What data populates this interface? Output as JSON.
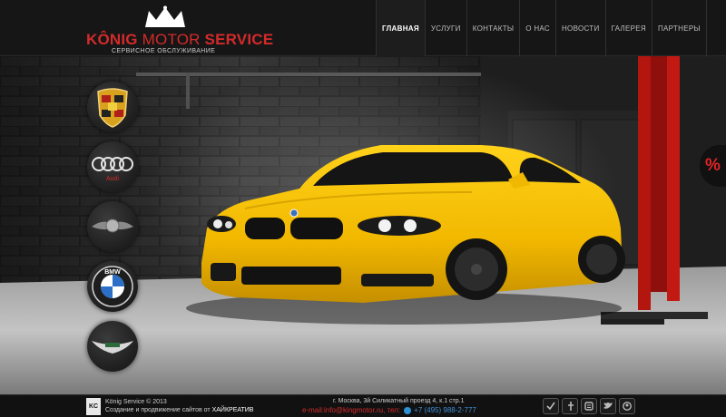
{
  "header": {
    "logo": {
      "brand_first": "KÔNIG",
      "brand_motor": " MOTOR ",
      "brand_last": "SERVICE",
      "tagline": "СЕРВИСНОЕ ОБСЛУЖИВАНИЕ"
    },
    "nav": [
      {
        "label": "ГЛАВНАЯ",
        "active": true
      },
      {
        "label": "УСЛУГИ"
      },
      {
        "label": "КОНТАКТЫ"
      },
      {
        "label": "О НАС"
      },
      {
        "label": "НОВОСТИ"
      },
      {
        "label": "ГАЛЕРЕЯ"
      },
      {
        "label": "ПАРТНЕРЫ"
      }
    ]
  },
  "hero": {
    "brands": [
      {
        "name": "Porsche",
        "icon": "porsche-crest-icon"
      },
      {
        "name": "Audi",
        "icon": "audi-rings-icon",
        "label": "Audi"
      },
      {
        "name": "Maybach",
        "icon": "maybach-winged-icon"
      },
      {
        "name": "BMW",
        "icon": "bmw-roundel-icon",
        "label": "BMW"
      },
      {
        "name": "Aston Martin",
        "icon": "aston-martin-wings-icon"
      }
    ],
    "promo": {
      "label": "%"
    },
    "colors": {
      "accent": "#d42a2a",
      "car": "#f5c400",
      "lift": "#b3150f"
    }
  },
  "footer": {
    "logo_text": "KC",
    "copyright": "König Service © 2013",
    "credit": "Создание и продвижение сайтов от ",
    "studio": "ХАЙКРЕАТИВ",
    "address": "г. Москва, 3й Силикатный проезд 4, к.1 стр.1",
    "email_label": "e-mail: ",
    "email": "info@kingmotor.ru",
    "phone_label": ", тел:",
    "phone": "+7 (495) 988-2-777",
    "socials": [
      "vk-icon",
      "facebook-icon",
      "blogger-icon",
      "twitter-icon",
      "odnoklassniki-icon"
    ]
  }
}
